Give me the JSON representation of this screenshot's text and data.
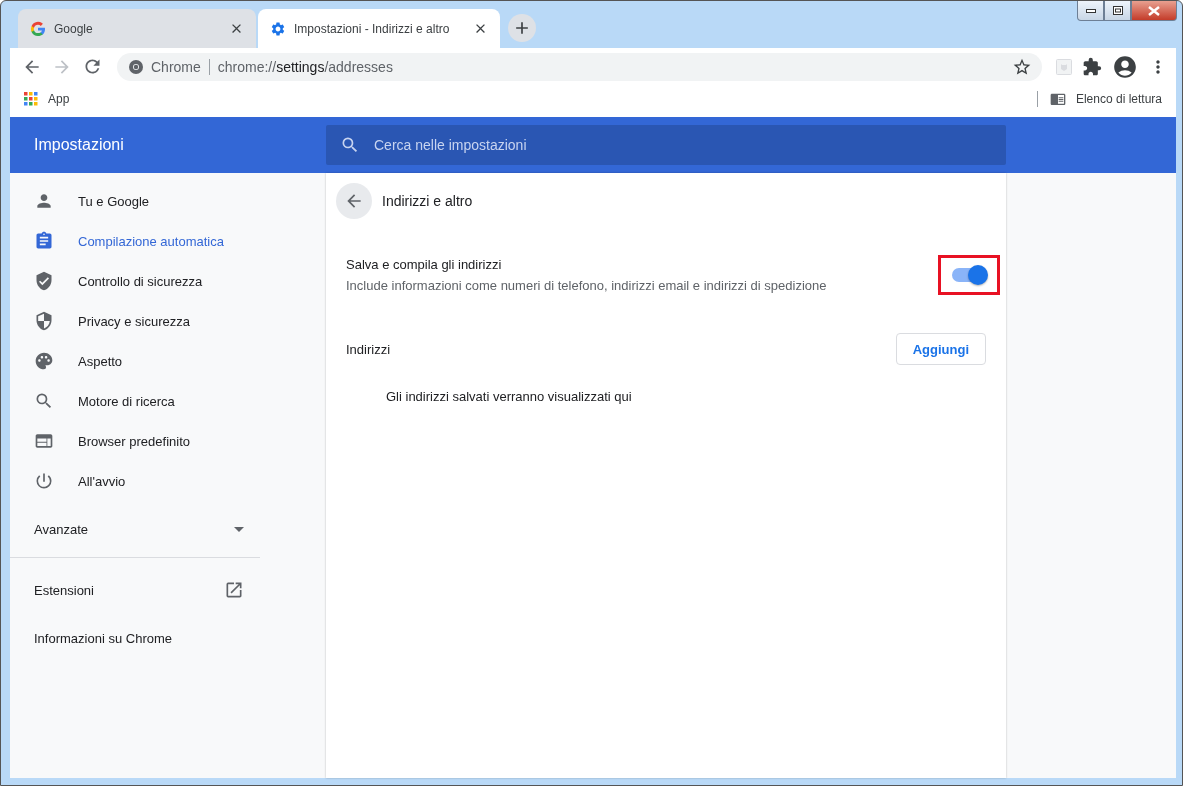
{
  "window": {
    "controls": [
      {
        "kind": "minimize"
      },
      {
        "kind": "maximize"
      },
      {
        "kind": "close"
      }
    ]
  },
  "tabs": [
    {
      "kind": "google",
      "title": "Google",
      "selected": false
    },
    {
      "kind": "settings",
      "title": "Impostazioni - Indirizzi e altro",
      "selected": true
    }
  ],
  "address_bar": {
    "site_label": "Chrome",
    "url": {
      "scheme": "chrome://",
      "host": "settings",
      "path": "/addresses"
    }
  },
  "bookmarks_bar": {
    "apps": "App",
    "reading_list": "Elenco di lettura"
  },
  "settings_header": {
    "title": "Impostazioni",
    "search": {
      "placeholder": "Cerca nelle impostazioni"
    }
  },
  "sidebar": {
    "items": [
      {
        "kind": "person",
        "label": "Tu e Google",
        "selected": false
      },
      {
        "kind": "clipboard",
        "label": "Compilazione automatica",
        "selected": true
      },
      {
        "kind": "shield-check",
        "label": "Controllo di sicurezza",
        "selected": false
      },
      {
        "kind": "shield",
        "label": "Privacy e sicurezza",
        "selected": false
      },
      {
        "kind": "palette",
        "label": "Aspetto",
        "selected": false
      },
      {
        "kind": "search",
        "label": "Motore di ricerca",
        "selected": false
      },
      {
        "kind": "browser",
        "label": "Browser predefinito",
        "selected": false
      },
      {
        "kind": "power",
        "label": "All'avvio",
        "selected": false
      }
    ],
    "advanced": {
      "label": "Avanzate",
      "expanded": false
    },
    "links": [
      {
        "label": "Estensioni",
        "external": true
      },
      {
        "label": "Informazioni su Chrome",
        "external": false
      }
    ]
  },
  "page": {
    "title": "Indirizzi e altro",
    "setting": {
      "label": "Salva e compila gli indirizzi",
      "description": "Include informazioni come numeri di telefono, indirizzi email e indirizzi di spedizione",
      "on": true,
      "highlighted": true
    },
    "section": {
      "title": "Indirizzi",
      "button": "Aggiungi",
      "empty_text": "Gli indirizzi salvati verranno visualizzati qui"
    }
  }
}
